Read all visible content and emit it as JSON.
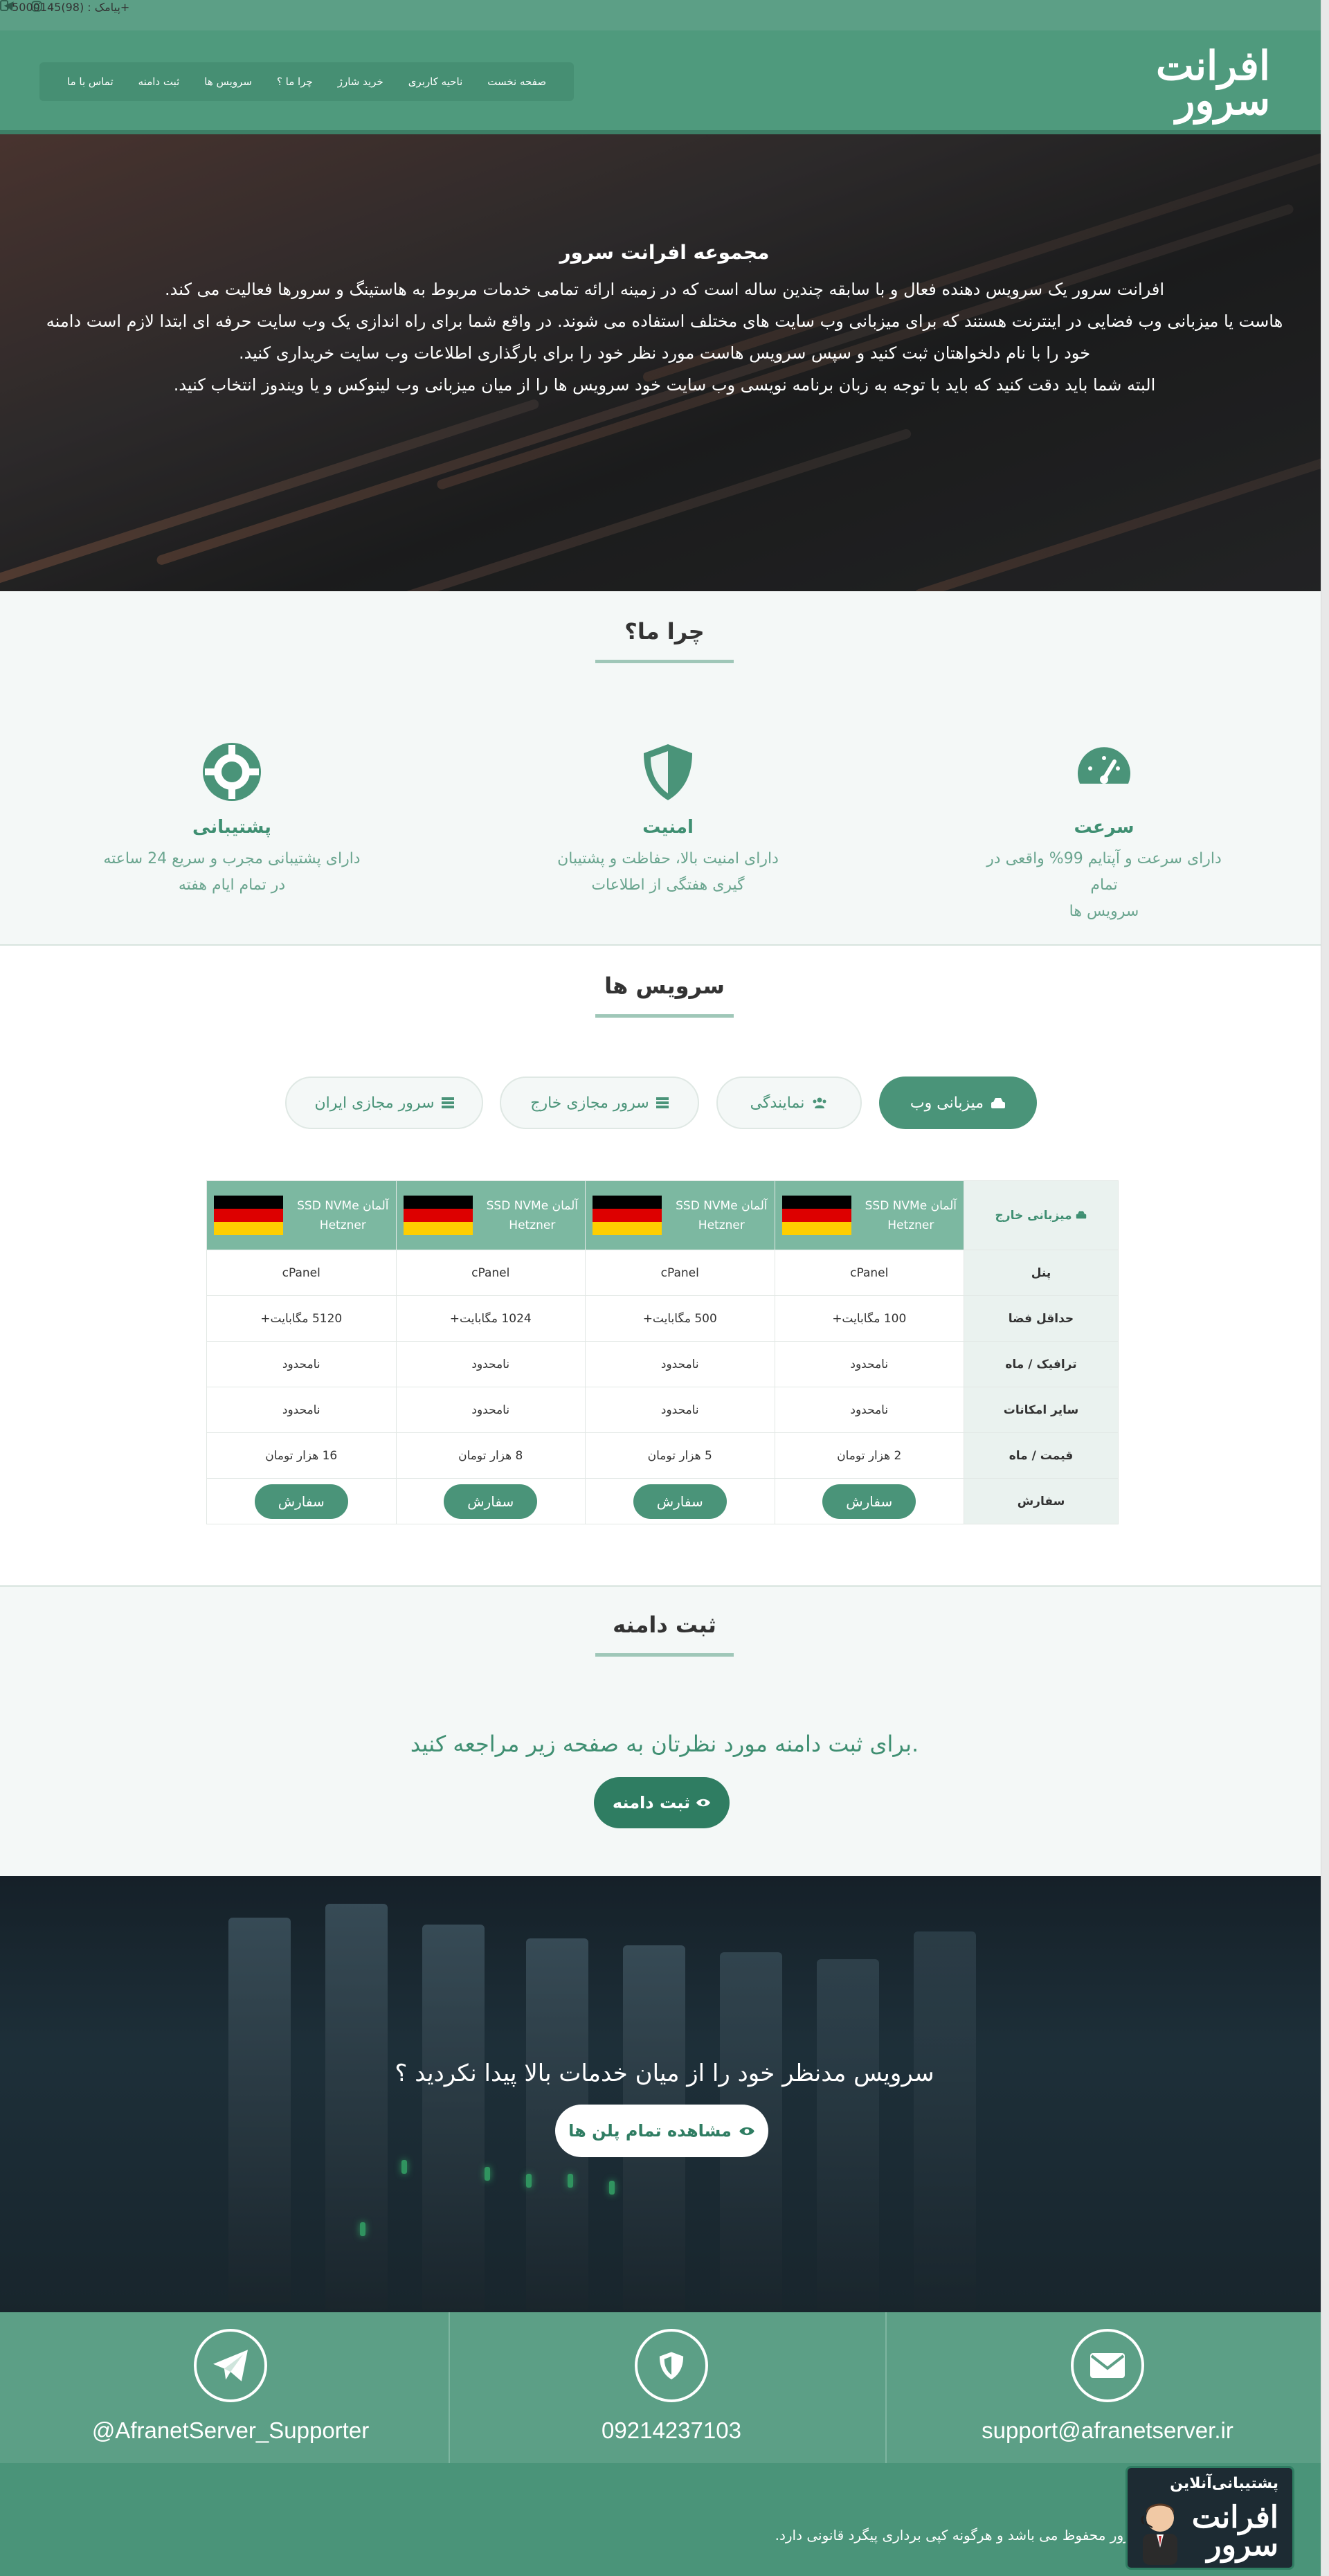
{
  "topbar": {
    "sms_label": "پیامک : (98)5000145+",
    "icons": [
      "telegram-icon",
      "instagram-icon"
    ]
  },
  "nav": {
    "logo_text": "افرانت سرور",
    "items": [
      "صفحه نخست",
      "ناحیه کاربری",
      "خرید شارژ",
      "چرا ما ؟",
      "سرویس ها",
      "ثبت دامنه",
      "تماس با ما"
    ]
  },
  "hero": {
    "title": "مجموعه افرانت سرور",
    "lines": [
      "افرانت سرور یک سرویس دهنده فعال و با سابقه چندین ساله است که در زمینه ارائه تمامی خدمات مربوط به هاستینگ و سرورها فعالیت می کند.",
      "هاست یا میزبانی وب فضایی در اینترنت هستند که برای میزبانی وب سایت های مختلف استفاده می شوند. در واقع شما برای راه اندازی یک وب سایت حرفه ای ابتدا لازم است دامنه",
      "خود را با نام دلخواهتان ثبت کنید و سپس سرویس هاست مورد نظر خود را برای بارگذاری اطلاعات وب سایت خریداری کنید.",
      "البته شما باید دقت کنید که باید با توجه به زبان برنامه نویسی وب سایت خود سرویس ها را از میان میزبانی وب لینوکس و یا ویندوز انتخاب کنید."
    ]
  },
  "why": {
    "title": "چرا ما؟",
    "features": [
      {
        "icon": "speedometer-icon",
        "title": "سرعت",
        "line1": "دارای سرعت و آپتایم 99% واقعی در تمام",
        "line2": "سرویس ها"
      },
      {
        "icon": "shield-icon",
        "title": "امنیت",
        "line1": "دارای امنیت بالا، حفاظت و پشتیبان",
        "line2": "گیری هفتگی از اطلاعات"
      },
      {
        "icon": "lifebuoy-icon",
        "title": "پشتیبانی",
        "line1": "دارای پشتیبانی مجرب و سریع 24 ساعته",
        "line2": "در تمام ایام هفته"
      }
    ]
  },
  "services": {
    "title": "سرویس ها",
    "tabs": [
      {
        "label": "میزبانی وب",
        "icon": "server-icon",
        "active": true
      },
      {
        "label": "نمایندگی",
        "icon": "users-icon",
        "active": false
      },
      {
        "label": "سرور مجازی خارج",
        "icon": "list-icon",
        "active": false
      },
      {
        "label": "سرور مجازی ایران",
        "icon": "list-icon",
        "active": false
      }
    ],
    "table": {
      "corner": "میزبانی خارج",
      "plans": [
        {
          "line1": "آلمان SSD NVMe",
          "line2": "Hetzner"
        },
        {
          "line1": "آلمان SSD NVMe",
          "line2": "Hetzner"
        },
        {
          "line1": "آلمان SSD NVMe",
          "line2": "Hetzner"
        },
        {
          "line1": "آلمان SSD NVMe",
          "line2": "Hetzner"
        }
      ],
      "rows": [
        {
          "label": "پنل",
          "cells": [
            "cPanel",
            "cPanel",
            "cPanel",
            "cPanel"
          ]
        },
        {
          "label": "حداقل فضا",
          "cells": [
            "100 مگابایت+",
            "500 مگابایت+",
            "1024 مگابایت+",
            "5120 مگابایت+"
          ]
        },
        {
          "label": "ترافیک / ماه",
          "cells": [
            "نامحدود",
            "نامحدود",
            "نامحدود",
            "نامحدود"
          ]
        },
        {
          "label": "سایر امکانات",
          "cells": [
            "نامحدود",
            "نامحدود",
            "نامحدود",
            "نامحدود"
          ]
        },
        {
          "label": "قیمت / ماه",
          "cells": [
            "2 هزار تومان",
            "5 هزار تومان",
            "8 هزار تومان",
            "16 هزار تومان"
          ]
        }
      ],
      "order_label": "سفارش",
      "order_button": "سفارش"
    },
    "flag_colors": [
      "#000000",
      "#dd0000",
      "#ffce00"
    ]
  },
  "domain": {
    "title": "ثبت دامنه",
    "text": ".برای ثبت دامنه مورد نظرتان به صفحه زیر مراجعه کنید",
    "button": "ثبت دامنه"
  },
  "cta": {
    "text": "سرویس مدنظر خود را از میان خدمات بالا پیدا نکردید ؟",
    "button": "مشاهده تمام پلن ها"
  },
  "contacts": [
    {
      "icon": "envelope-icon",
      "value": "support@afranetserver.ir"
    },
    {
      "icon": "shield-icon",
      "value": "09214237103"
    },
    {
      "icon": "telegram-icon",
      "value": "@AfranetServer_Supporter"
    }
  ],
  "footer": {
    "text": "تمامی حقوق برای افرانت سرور محفوظ می باشد و هرگونه کپی برداری پیگرد قانونی دارد.",
    "support_label": "پشتیبانی‌آنلاین",
    "support_logo": "افرانت سرور"
  },
  "colors": {
    "brand": "#4a9479",
    "brand_dark": "#2f7d62",
    "brand_light": "#7cb8a1",
    "page_bg": "#f4f8f7"
  }
}
